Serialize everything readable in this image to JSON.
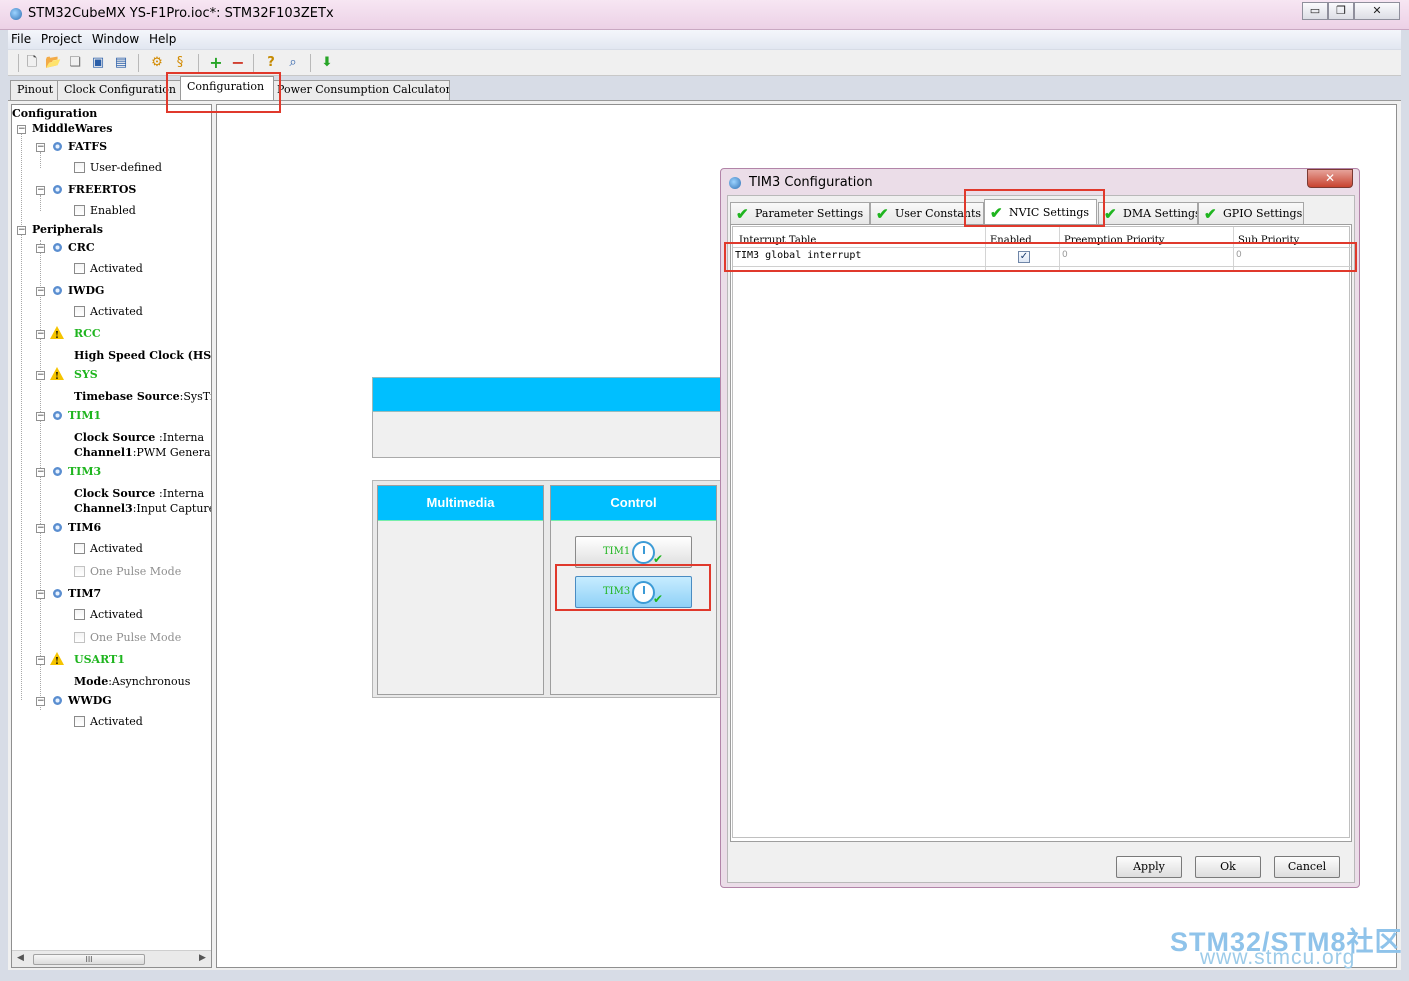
{
  "window": {
    "title": "STM32CubeMX YS-F1Pro.ioc*: STM32F103ZETx",
    "minimize": "▭",
    "maximize": "❐",
    "close": "✕"
  },
  "menu": [
    "File",
    "Project",
    "Window",
    "Help"
  ],
  "toolbar": {
    "icons": [
      "new-project-icon",
      "open-project-icon",
      "copy-icon",
      "save-icon",
      "save-as-icon",
      "generate-report-icon",
      "generate-code-icon",
      "add-icon",
      "remove-icon",
      "help-icon",
      "find-icon",
      "download-icon"
    ]
  },
  "main_tabs": [
    {
      "label": "Pinout",
      "active": false
    },
    {
      "label": "Clock Configuration",
      "active": false
    },
    {
      "label": "Configuration",
      "active": true
    },
    {
      "label": "Power Consumption Calculator",
      "active": false
    }
  ],
  "tree": {
    "root": "Configuration",
    "middlewares": "MiddleWares",
    "fatfs": "FATFS",
    "fatfs_child": "User-defined",
    "freertos": "FREERTOS",
    "freertos_child": "Enabled",
    "peripherals": "Peripherals",
    "crc": "CRC",
    "crc_child": "Activated",
    "iwdg": "IWDG",
    "iwdg_child": "Activated",
    "rcc": "RCC",
    "rcc_child_key": "High Speed Clock (HS",
    "sys": "SYS",
    "sys_child_key": "Timebase Source",
    "sys_child_val": ":SysTi",
    "tim1": "TIM1",
    "tim1_c1_key": "Clock Source ",
    "tim1_c1_val": ":Interna",
    "tim1_c2_key": "Channel1",
    "tim1_c2_val": ":PWM Generatic",
    "tim3": "TIM3",
    "tim3_c1_key": "Clock Source ",
    "tim3_c1_val": ":Interna",
    "tim3_c2_key": "Channel3",
    "tim3_c2_val": ":Input Capture",
    "tim6": "TIM6",
    "tim6_c1": "Activated",
    "tim6_c2": "One Pulse Mode",
    "tim7": "TIM7",
    "tim7_c1": "Activated",
    "tim7_c2": "One Pulse Mode",
    "usart1": "USART1",
    "usart1_child_key": "Mode",
    "usart1_child_val": ":Asynchronous",
    "wwdg": "WWDG",
    "wwdg_child": "Activated",
    "scroll_thumb": "III"
  },
  "canvas": {
    "multimedia": "Multimedia",
    "control": "Control",
    "tim1_btn": "TIM1",
    "tim3_btn": "TIM3"
  },
  "dialog": {
    "title": "TIM3 Configuration",
    "close": "✕",
    "tabs": [
      "Parameter Settings",
      "User Constants",
      "NVIC Settings",
      "DMA Settings",
      "GPIO Settings"
    ],
    "table_headers": [
      "Interrupt Table",
      "Enabled",
      "Preemption Priority",
      "Sub Priority"
    ],
    "row": {
      "name": "TIM3 global interrupt",
      "enabled": "✓",
      "preemption": "0",
      "sub": "0"
    },
    "buttons": {
      "apply": "Apply",
      "ok": "Ok",
      "cancel": "Cancel"
    }
  },
  "watermark": {
    "line1": "STM32/STM8社区",
    "line2": "www.stmcu.org"
  },
  "colors": {
    "accent_cyan": "#00bfff",
    "ok_green": "#1fb51f",
    "annotation_red": "#e0392c"
  }
}
